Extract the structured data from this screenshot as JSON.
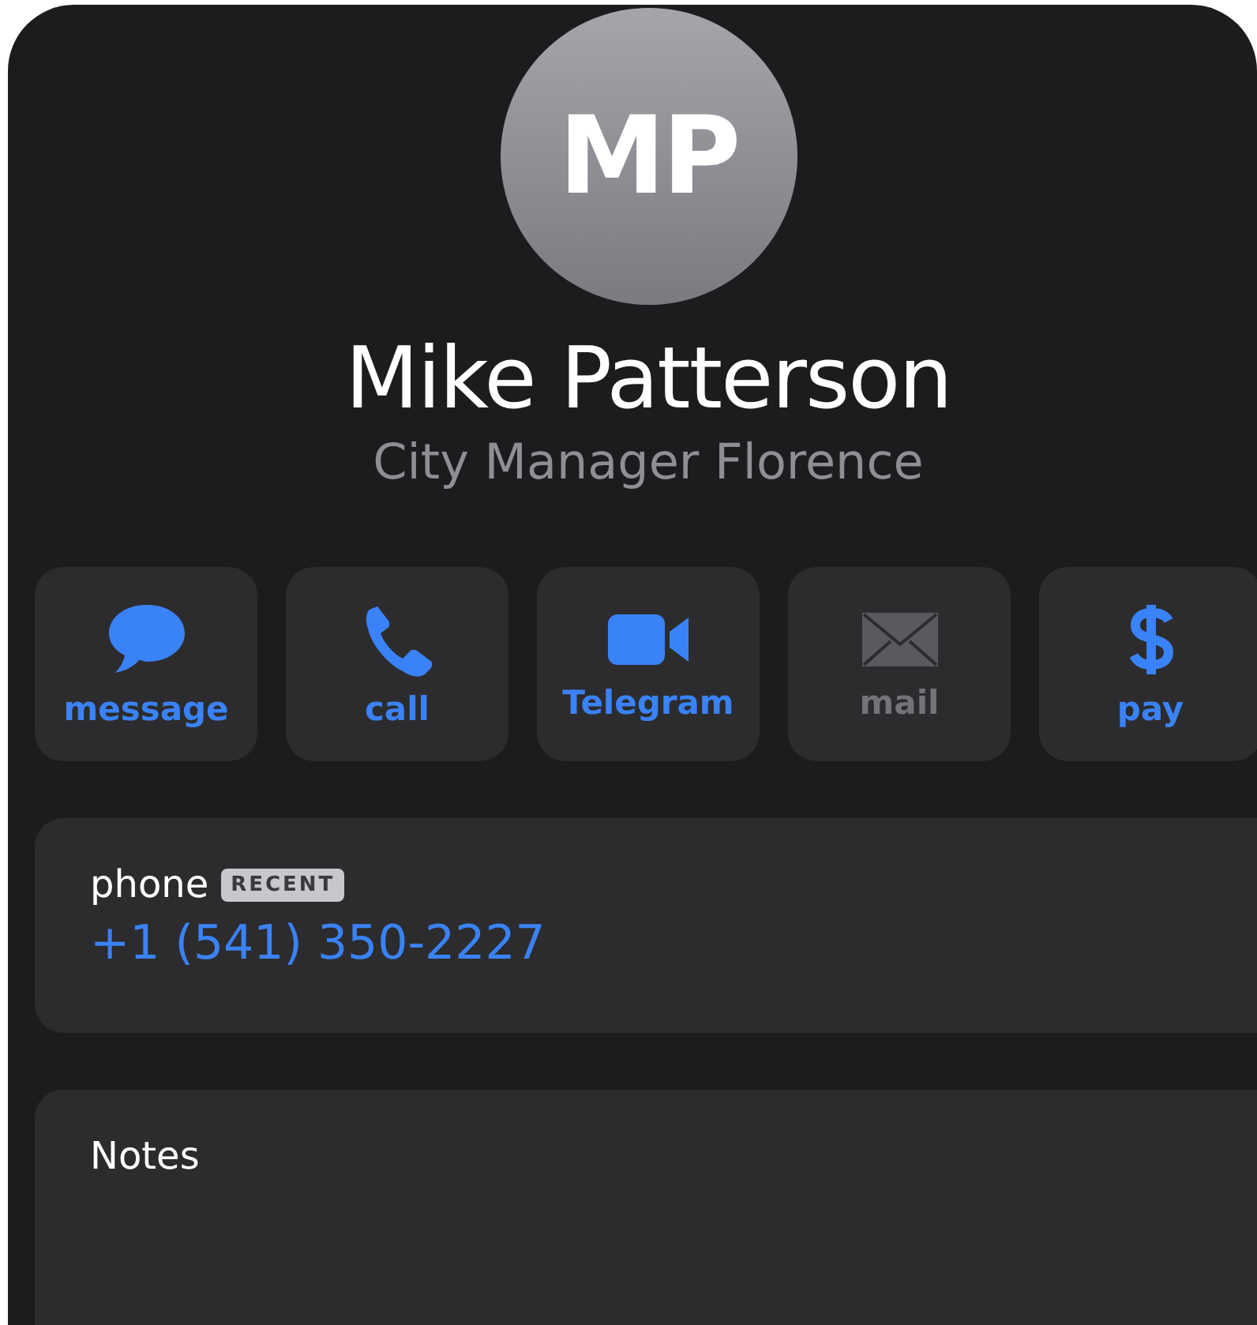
{
  "contact": {
    "initials": "MP",
    "name": "Mike Patterson",
    "subtitle": "City Manager Florence"
  },
  "actions": [
    {
      "kind": "message",
      "label": "message",
      "disabled": false
    },
    {
      "kind": "call",
      "label": "call",
      "disabled": false
    },
    {
      "kind": "video",
      "label": "Telegram",
      "disabled": false
    },
    {
      "kind": "mail",
      "label": "mail",
      "disabled": true
    },
    {
      "kind": "pay",
      "label": "pay",
      "disabled": false
    }
  ],
  "phone": {
    "label": "phone",
    "badge": "RECENT",
    "number": "+1 (541) 350-2227"
  },
  "notes": {
    "label": "Notes"
  }
}
